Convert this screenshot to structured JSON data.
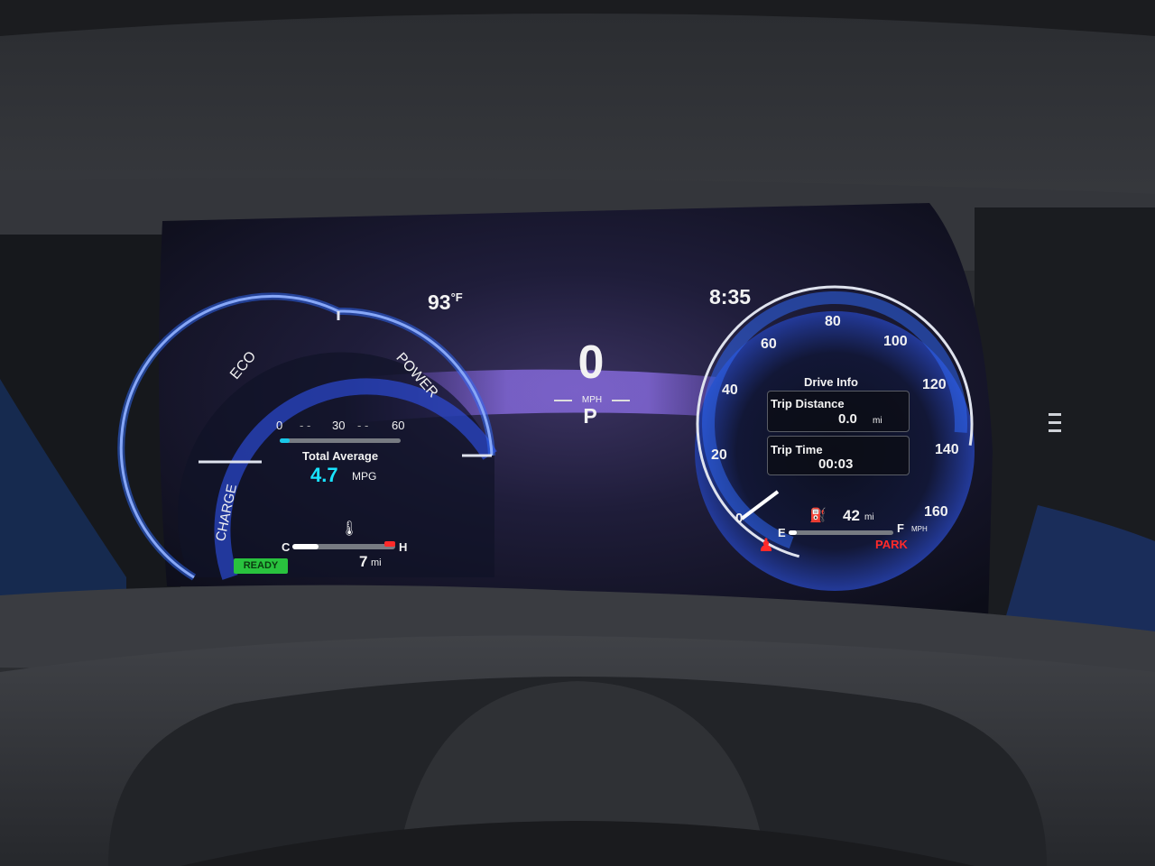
{
  "status": {
    "temperature": "93",
    "temperature_unit": "°F",
    "clock": "8:35"
  },
  "speed": {
    "value": "0",
    "unit": "MPH",
    "gear": "P"
  },
  "hybrid_meter": {
    "labels": [
      "ECO",
      "POWER",
      "CHARGE"
    ],
    "mini_scale": [
      "0",
      "30",
      "60"
    ],
    "mini_level_fraction": 0.08,
    "avg_title": "Total Average",
    "avg_value": "4.7",
    "avg_unit": "MPG",
    "temp_low": "C",
    "temp_high": "H",
    "temp_level_fraction": 0.25,
    "ev_range": "7",
    "ev_range_unit": "mi",
    "ready_label": "READY"
  },
  "speedometer": {
    "ticks": [
      "0",
      "20",
      "40",
      "60",
      "80",
      "100",
      "120",
      "140",
      "160"
    ],
    "unit": "MPH",
    "needle_value": 0
  },
  "drive_info": {
    "title": "Drive Info",
    "trip_distance_label": "Trip Distance",
    "trip_distance_value": "0.0",
    "trip_distance_unit": "mi",
    "trip_time_label": "Trip Time",
    "trip_time_value": "00:03"
  },
  "fuel": {
    "empty": "E",
    "full": "F",
    "range_value": "42",
    "range_unit": "mi",
    "level_fraction": 0.08
  },
  "indicators": {
    "park": "PARK"
  },
  "colors": {
    "accent_blue": "#2f6bff",
    "ready_green": "#29c23e",
    "park_red": "#ff2a2a",
    "mpg_cyan": "#19e3ff"
  }
}
